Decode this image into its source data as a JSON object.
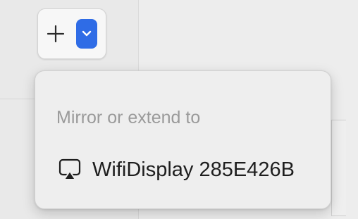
{
  "colors": {
    "accent": "#2f6ce6",
    "menu_background": "#eeeeee",
    "header_text": "#9a9a9a",
    "item_text": "#1e1e1e"
  },
  "toolbar": {
    "add_icon": "plus-icon",
    "dropdown_icon": "chevron-down-icon"
  },
  "menu": {
    "header": "Mirror or extend to",
    "items": [
      {
        "icon": "airplay-display-icon",
        "label": "WifiDisplay 285E426B"
      }
    ]
  }
}
